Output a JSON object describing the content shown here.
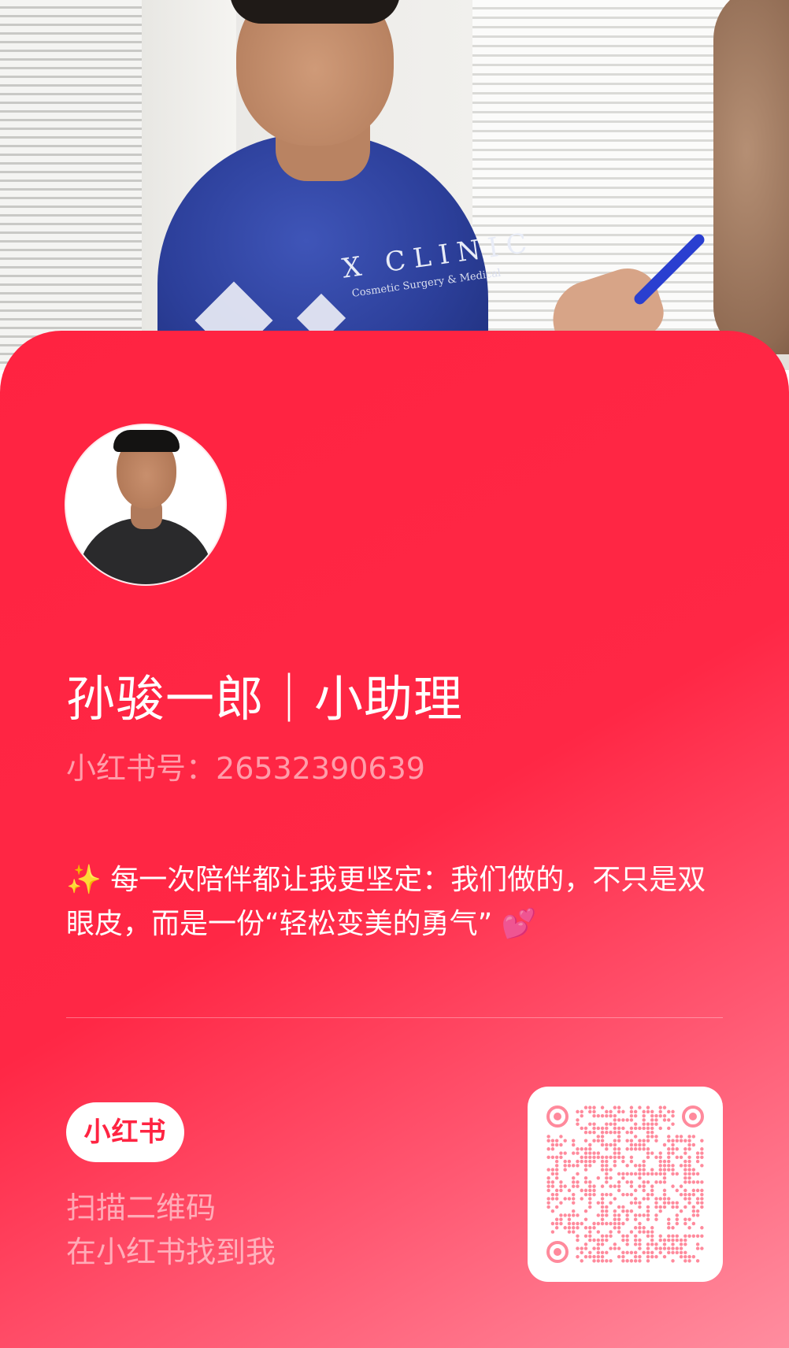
{
  "profile": {
    "name": "孙骏一郎｜小助理",
    "id_label": "小红书号：",
    "id_value": "26532390639",
    "bio": "每一次陪伴都让我更坚定：我们做的，不只是双眼皮，而是一份“轻松变美的勇气”",
    "bio_lead_emoji": "✨",
    "bio_trail_emoji": "💕"
  },
  "photo": {
    "shirt_text": "X CLINIC",
    "shirt_subtext": "Cosmetic Surgery & Medical"
  },
  "footer": {
    "brand_label": "小红书",
    "scan_line1": "扫描二维码",
    "scan_line2": "在小红书找到我"
  },
  "colors": {
    "card_red": "#ff2442",
    "qr_dots": "#ff8a9c",
    "white": "#ffffff"
  },
  "icons": {
    "avatar": "avatar-image",
    "qr": "qr-code-icon",
    "brand": "xiaohongshu-logo"
  }
}
